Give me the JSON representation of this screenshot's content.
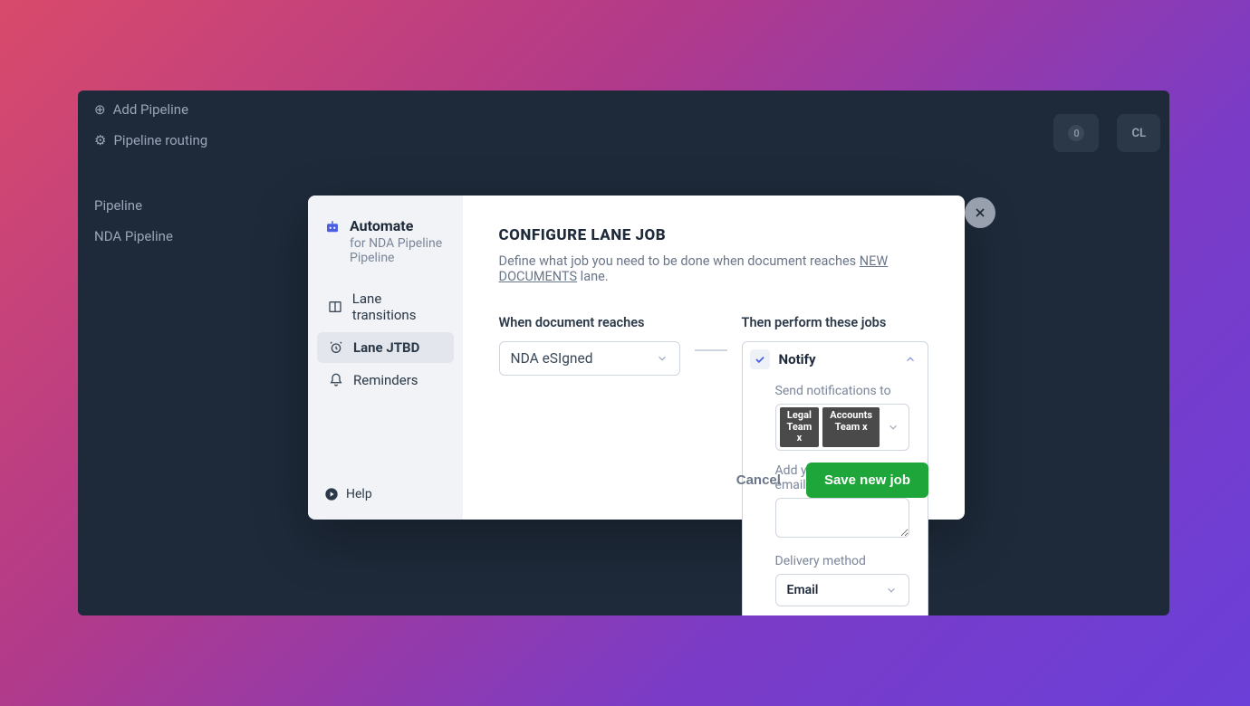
{
  "background": {
    "nav": {
      "add_pipeline": "Add Pipeline",
      "pipeline_routing": "Pipeline routing",
      "pipeline": "Pipeline",
      "nda_pipeline": "NDA Pipeline"
    },
    "tabs": {
      "tab1_badge": "0",
      "tab2_label": "CL"
    }
  },
  "sidebar": {
    "title": "Automate",
    "subtitle": "for NDA Pipeline Pipeline",
    "items": [
      {
        "label": "Lane transitions"
      },
      {
        "label": "Lane JTBD"
      },
      {
        "label": "Reminders"
      }
    ],
    "help_label": "Help"
  },
  "main": {
    "heading": "CONFIGURE LANE JOB",
    "subtitle_prefix": "Define what job you need to be done when document reaches ",
    "subtitle_lane": "NEW DOCUMENTS",
    "subtitle_suffix": " lane.",
    "when_label": "When document reaches",
    "when_value": "NDA eSIgned",
    "then_label": "Then perform these jobs",
    "job": {
      "title": "Notify",
      "recipients_label": "Send notifications to",
      "recipients": [
        "Legal Team x",
        "Accounts Team x"
      ],
      "message_label": "Add your message for email",
      "message_value": "",
      "delivery_label": "Delivery method",
      "delivery_value": "Email"
    },
    "cancel_label": "Cancel",
    "save_label": "Save new job"
  }
}
